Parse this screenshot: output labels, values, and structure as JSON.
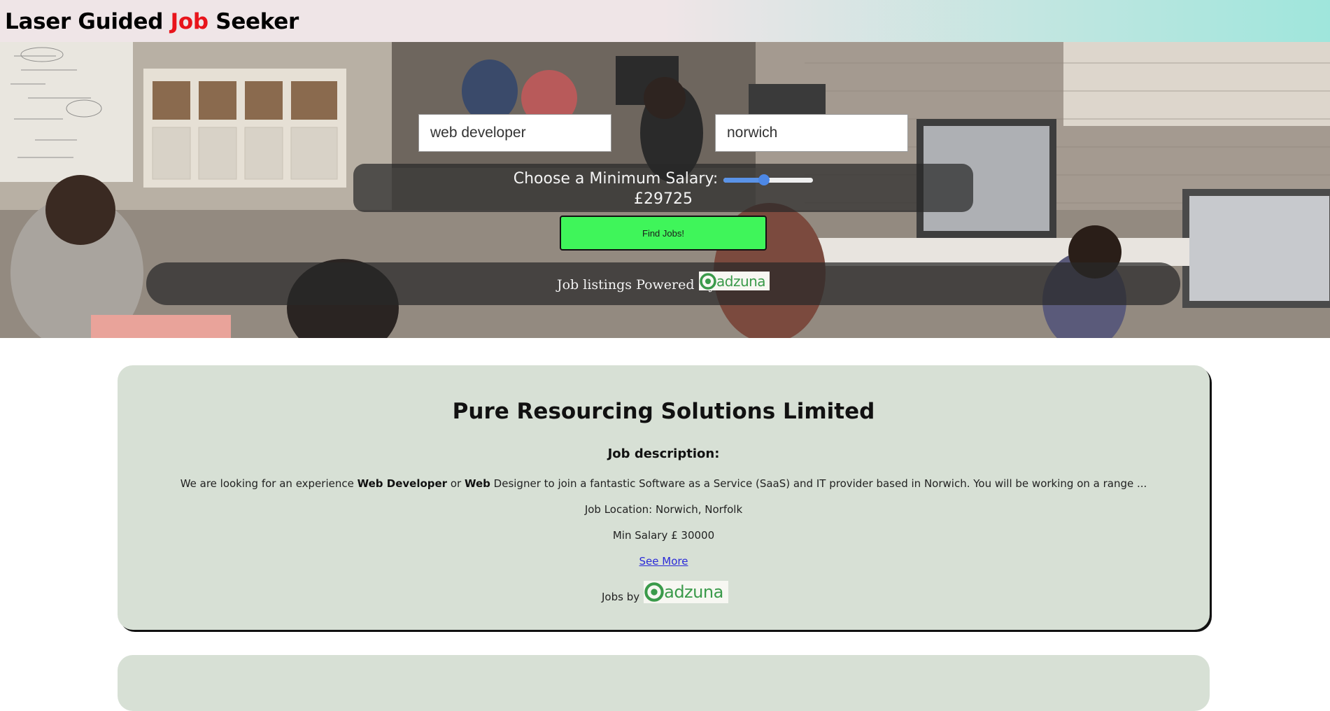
{
  "header": {
    "title_part1": "Laser Guided ",
    "title_accent": "Job",
    "title_part2": " Seeker",
    "accent_color": "#e8141b"
  },
  "search": {
    "keyword_value": "web developer",
    "location_value": "norwich",
    "salary_label": "Choose a Minimum Salary:",
    "salary_slider_fraction": 0.45,
    "salary_value": "£29725",
    "find_button_label": "Find Jobs!",
    "find_button_color": "#3ff55a",
    "powered_by_text": "Job listings Powered By",
    "logo_text": "adzuna"
  },
  "jobs": [
    {
      "company": "Pure Resourcing Solutions Limited",
      "description_heading": "Job description:",
      "description_pre": "We are looking for an experience ",
      "description_bold1": "Web Developer",
      "description_mid1": " or ",
      "description_bold2": "Web",
      "description_post": " Designer to join a fantastic Software as a Service (SaaS) and IT provider based in Norwich. You will be working on a range ...",
      "location": "Job Location: Norwich, Norfolk",
      "min_salary": "Min Salary £ 30000",
      "see_more_label": "See More",
      "jobs_by_label": "Jobs by",
      "logo_text": "adzuna"
    }
  ],
  "icons": {
    "logo_icon": "adzuna-swirl-icon"
  }
}
